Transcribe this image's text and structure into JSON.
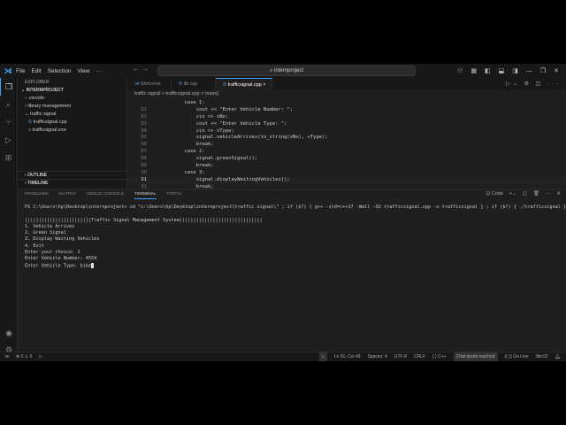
{
  "title_bar": {
    "menu": [
      "File",
      "Edit",
      "Selection",
      "View",
      "···"
    ],
    "search": "internproject"
  },
  "sidebar": {
    "header": "EXPLORER",
    "project": "INTERNPROJECT",
    "items": [
      ".vscode",
      "library management",
      "traffic signal",
      "trafficsignal.cpp",
      "trafficsignal.exe"
    ],
    "outline": "OUTLINE",
    "timeline": "TIMELINE"
  },
  "tabs": [
    {
      "label": "Welcome"
    },
    {
      "label": "lib.cpp"
    },
    {
      "label": "trafficsignal.cpp",
      "close": "×"
    }
  ],
  "breadcrumb": "traffic signal > trafficsignal.cpp > main()",
  "code": [
    {
      "n": "",
      "t": "        case 1:"
    },
    {
      "n": "81",
      "t": "            cout << \"Enter Vehicle Number: \";"
    },
    {
      "n": "82",
      "t": "            cin >> vNo;"
    },
    {
      "n": "83",
      "t": "            cout << \"Enter Vehicle Type: \";"
    },
    {
      "n": "84",
      "t": "            cin >> vType;"
    },
    {
      "n": "85",
      "t": "            signal.vehicleArrives(to_string(vNo), vType);"
    },
    {
      "n": "86",
      "t": "            break;"
    },
    {
      "n": "87",
      "t": "        case 2:"
    },
    {
      "n": "88",
      "t": "            signal.greenSignal();"
    },
    {
      "n": "89",
      "t": "            break;"
    },
    {
      "n": "90",
      "t": "        case 3:"
    },
    {
      "n": "91",
      "t": "            signal.displayWaitingVehicles();"
    },
    {
      "n": "92",
      "t": "            break;"
    }
  ],
  "panel": {
    "tabs": [
      "PROBLEMS",
      "OUTPUT",
      "DEBUG CONSOLE",
      "TERMINAL",
      "PORTS"
    ],
    "shell": "Code"
  },
  "terminal": [
    "PS C:\\Users\\hp\\Desktop\\internproject> cd \"c:\\Users\\hp\\Desktop\\internproject\\traffic signal\\\" ; if ($?) { g++ -std=c++17 -Wall -O2 trafficsignal.cpp -o trafficsignal } ; if ($?) { ./trafficsignal }",
    "",
    "||||||||||||||||||||||||Traffic Signal Management System||||||||||||||||||||||||||||||",
    "1. Vehicle Arrives",
    "2. Green Signal",
    "3. Display Waiting Vehicles",
    "4. Exit",
    "Enter your choice: 1",
    "Enter Vehicle Number: 4554",
    "Enter Vehicle Type: bike"
  ],
  "status": {
    "errors": "0",
    "warnings": "0",
    "position": "Ln 91, Col 49",
    "spaces": "Spaces: 4",
    "encoding": "UTF-8",
    "eol": "CRLF",
    "language": "{ } C++",
    "chat": "Chat quota reached",
    "golive": "((·)) Go Live",
    "platform": "Win32"
  }
}
